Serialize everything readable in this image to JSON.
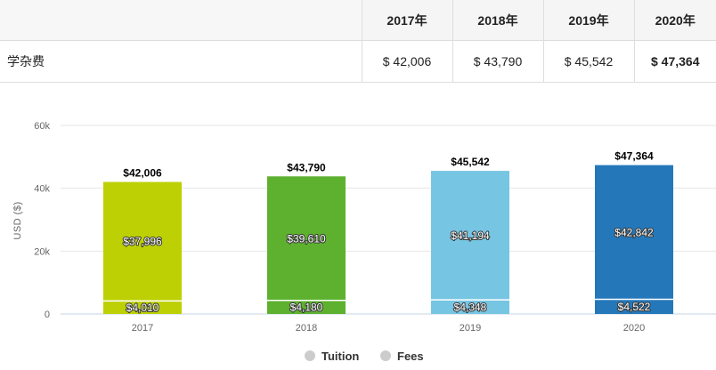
{
  "table": {
    "row_label": "学杂费",
    "headers": [
      "2017年",
      "2018年",
      "2019年",
      "2020年"
    ],
    "values": [
      "$ 42,006",
      "$ 43,790",
      "$ 45,542",
      "$ 47,364"
    ]
  },
  "chart_data": {
    "type": "bar",
    "stacked": true,
    "categories": [
      "2017",
      "2018",
      "2019",
      "2020"
    ],
    "series": [
      {
        "name": "Tuition",
        "values": [
          37996,
          39610,
          41194,
          42842
        ]
      },
      {
        "name": "Fees",
        "values": [
          4010,
          4180,
          4348,
          4522
        ]
      }
    ],
    "totals": [
      42006,
      43790,
      45542,
      47364
    ],
    "total_labels": [
      "$42,006",
      "$43,790",
      "$45,542",
      "$47,364"
    ],
    "tuition_labels": [
      "$37,996",
      "$39,610",
      "$41,194",
      "$42,842"
    ],
    "fees_labels": [
      "$4,010",
      "$4,180",
      "$4,348",
      "$4,522"
    ],
    "bar_colors": [
      "#bdd004",
      "#5db12f",
      "#76c5e3",
      "#2478ba"
    ],
    "yticks": [
      "0",
      "20k",
      "40k",
      "60k"
    ],
    "ytick_values": [
      0,
      20000,
      40000,
      60000
    ],
    "ylim": [
      0,
      60000
    ],
    "ylabel": "USD ($)",
    "grid": true,
    "legend_position": "bottom-center",
    "legend_marker_color": "#cccccc"
  }
}
